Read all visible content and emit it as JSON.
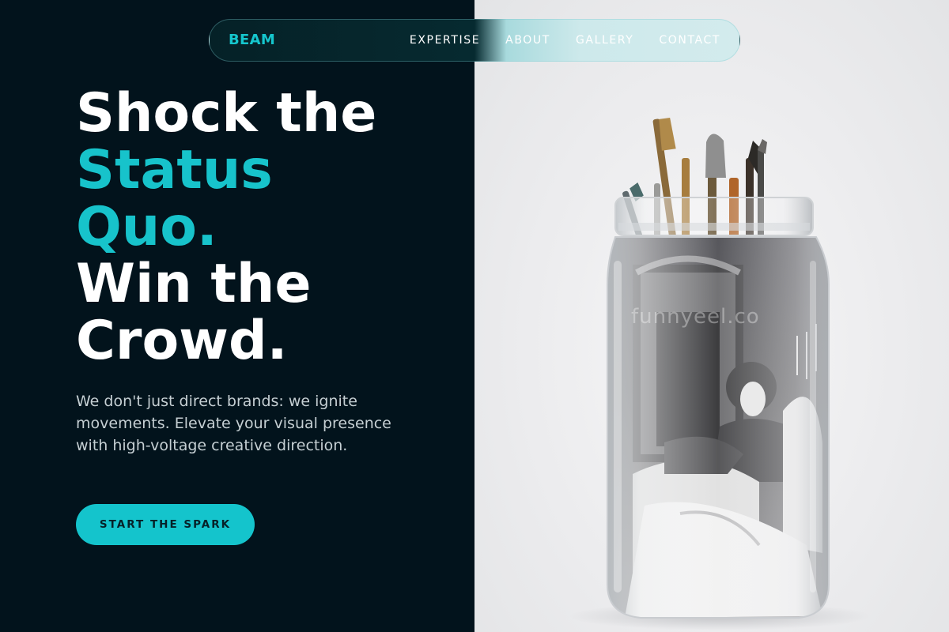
{
  "nav": {
    "brand": "BEAM",
    "links": [
      "EXPERTISE",
      "ABOUT",
      "GALLERY",
      "CONTACT"
    ]
  },
  "hero": {
    "line1": "Shock the",
    "line2": "Status",
    "line3": "Quo.",
    "line4": "Win the",
    "line5": "Crowd.",
    "subtitle": "We don't just direct brands: we ignite movements. Elevate your visual presence with high-voltage creative direction.",
    "cta_label": "START THE SPARK"
  },
  "image": {
    "watermark": "funnyeel.co"
  },
  "colors": {
    "background": "#02131c",
    "accent": "#17c3cb",
    "text": "#ffffff",
    "muted_text": "#c5cfd3"
  }
}
